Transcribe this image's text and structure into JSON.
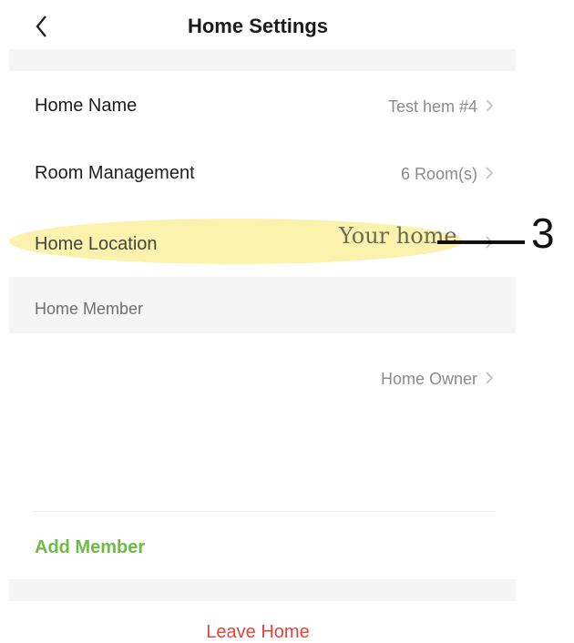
{
  "header": {
    "title": "Home Settings",
    "back_icon": "chevron-left-icon"
  },
  "settings": {
    "home_name": {
      "label": "Home Name",
      "value": "Test hem #4"
    },
    "room_management": {
      "label": "Room Management",
      "value": "6 Room(s)"
    },
    "home_location": {
      "label": "Home Location"
    }
  },
  "annotation": {
    "text": "Your home",
    "number": "3",
    "highlight_color": "#fbf1a6"
  },
  "members": {
    "header": "Home Member",
    "owner_role": "Home Owner",
    "add_label": "Add Member"
  },
  "actions": {
    "leave_label": "Leave Home"
  },
  "colors": {
    "accent_green": "#6dbb45",
    "danger_red": "#e0443c",
    "section_bg": "#f5f5f6"
  }
}
